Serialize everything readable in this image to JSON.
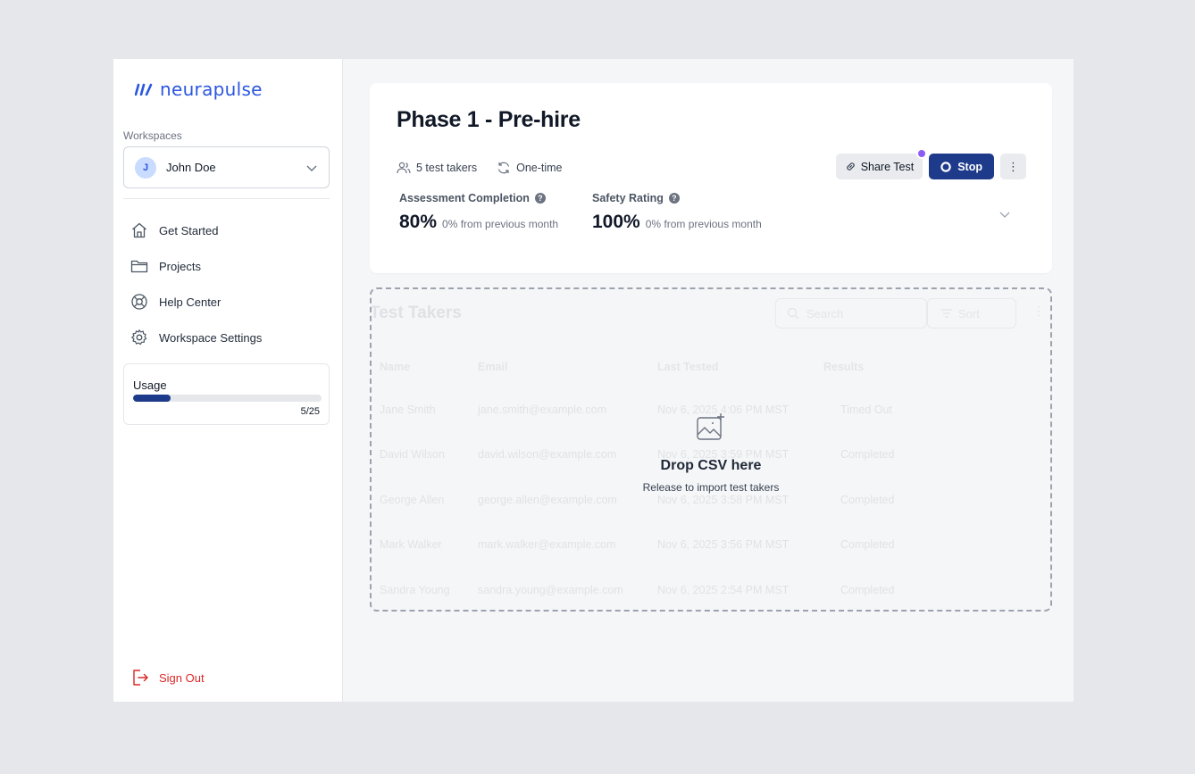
{
  "brand": {
    "name": "neurapulse",
    "color": "#2b56e0"
  },
  "sidebar": {
    "workspaces_label": "Workspaces",
    "workspace": {
      "initial": "J",
      "name": "John Doe"
    },
    "nav": [
      {
        "label": "Get Started",
        "icon": "home-icon"
      },
      {
        "label": "Projects",
        "icon": "folder-icon"
      },
      {
        "label": "Help Center",
        "icon": "lifebuoy-icon"
      },
      {
        "label": "Workspace Settings",
        "icon": "gear-icon"
      }
    ],
    "usage": {
      "label": "Usage",
      "used": 5,
      "total": 25,
      "count_text": "5/25"
    },
    "sign_out": "Sign Out"
  },
  "header": {
    "title": "Phase 1 - Pre-hire",
    "test_takers": "5 test takers",
    "frequency": "One-time",
    "share_label": "Share Test",
    "stop_label": "Stop",
    "more_label": "⋮"
  },
  "stats": [
    {
      "label": "Assessment Completion",
      "value": "80%",
      "sub": "0% from previous month"
    },
    {
      "label": "Safety Rating",
      "value": "100%",
      "sub": "0% from previous month"
    }
  ],
  "table": {
    "title": "Test Takers",
    "search_placeholder": "Search",
    "sort_label": "Sort",
    "columns": [
      "Name",
      "Email",
      "Last Tested",
      "Results"
    ],
    "rows": [
      {
        "name": "Jane Smith",
        "email": "jane.smith@example.com",
        "last_tested": "Nov 6, 2025 4:06 PM MST",
        "result": "Timed Out"
      },
      {
        "name": "David Wilson",
        "email": "david.wilson@example.com",
        "last_tested": "Nov 6, 2025 3:59 PM MST",
        "result": "Completed"
      },
      {
        "name": "George Allen",
        "email": "george.allen@example.com",
        "last_tested": "Nov 6, 2025 3:58 PM MST",
        "result": "Completed"
      },
      {
        "name": "Mark Walker",
        "email": "mark.walker@example.com",
        "last_tested": "Nov 6, 2025 3:56 PM MST",
        "result": "Completed"
      },
      {
        "name": "Sandra Young",
        "email": "sandra.young@example.com",
        "last_tested": "Nov 6, 2025 2:54 PM MST",
        "result": "Completed"
      }
    ]
  },
  "dropzone": {
    "title": "Drop CSV here",
    "subtitle": "Release to import test takers"
  }
}
